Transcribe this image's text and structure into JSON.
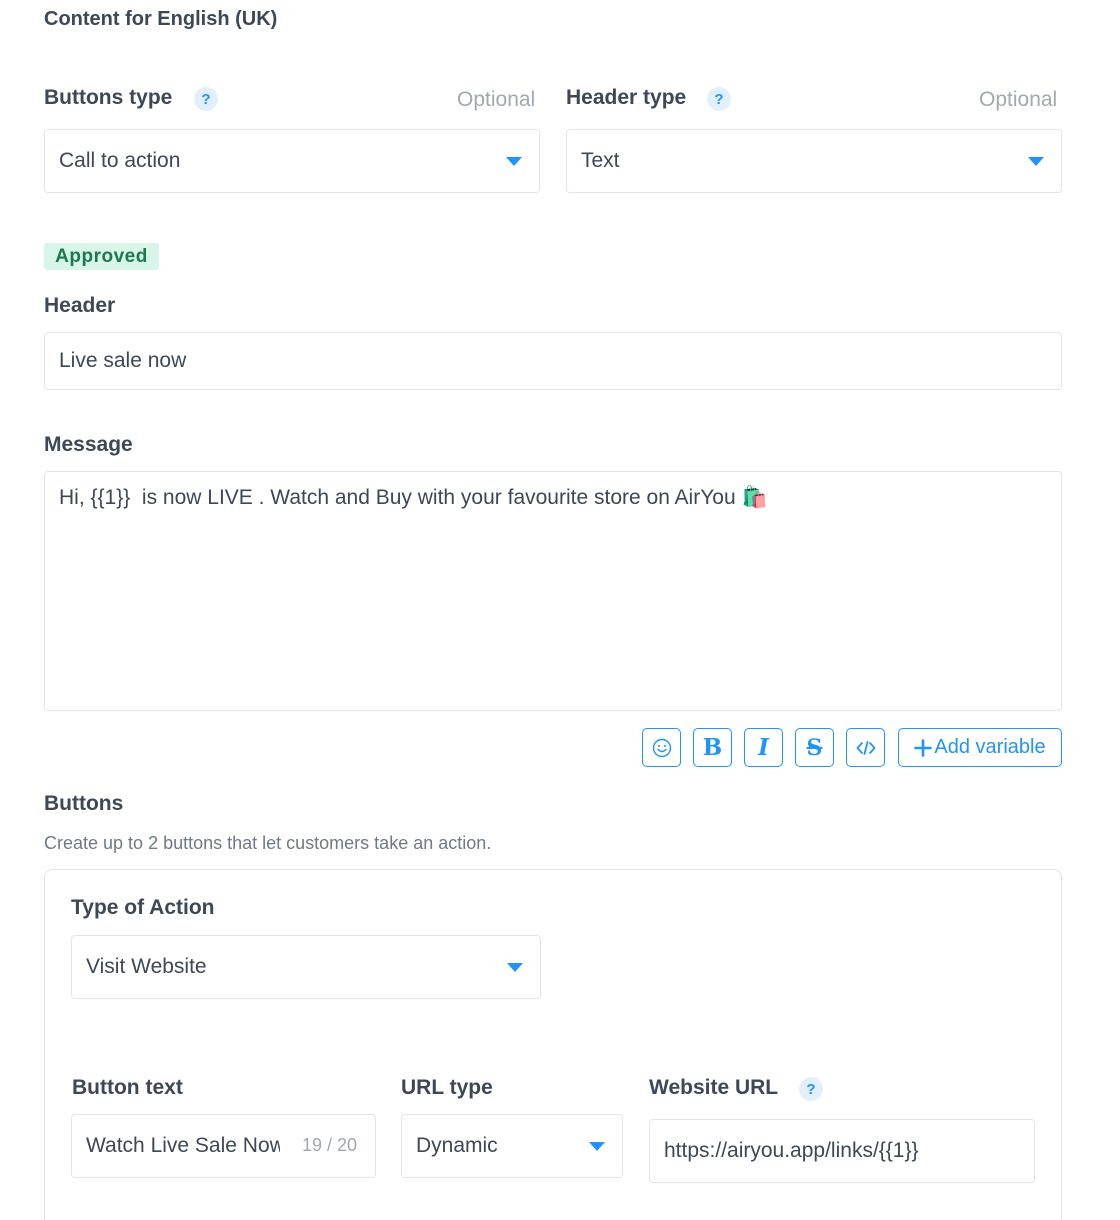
{
  "page": {
    "title": "Content for English (UK)"
  },
  "buttons_type": {
    "label": "Buttons type",
    "optional": "Optional",
    "value": "Call to action"
  },
  "header_type": {
    "label": "Header type",
    "optional": "Optional",
    "value": "Text"
  },
  "status": {
    "badge": "Approved"
  },
  "header": {
    "label": "Header",
    "value": "Live sale now"
  },
  "message": {
    "label": "Message",
    "value": "Hi, {{1}}  is now LIVE . Watch and Buy with your favourite store on AirYou 🛍️"
  },
  "toolbar": {
    "emoji_icon": "smiley-icon",
    "bold_label": "B",
    "italic_label": "I",
    "strike_label": "S",
    "code_icon": "code-icon",
    "add_variable_label": "Add variable"
  },
  "buttons_section": {
    "title": "Buttons",
    "hint": "Create up to 2 buttons that let customers take an action."
  },
  "action": {
    "type_label": "Type of Action",
    "type_value": "Visit Website",
    "button_text_label": "Button text",
    "button_text_value": "Watch Live Sale Now",
    "button_text_counter": "19 / 20",
    "url_type_label": "URL type",
    "url_type_value": "Dynamic",
    "website_url_label": "Website URL",
    "website_url_value": "https://airyou.app/links/{{1}}"
  },
  "colors": {
    "accent": "#1f93ff",
    "text": "#3c4858",
    "muted": "#a0a8b3",
    "border": "#e0e6ed",
    "approved_bg": "#d7f5e8",
    "approved_text": "#1a7a4c"
  }
}
